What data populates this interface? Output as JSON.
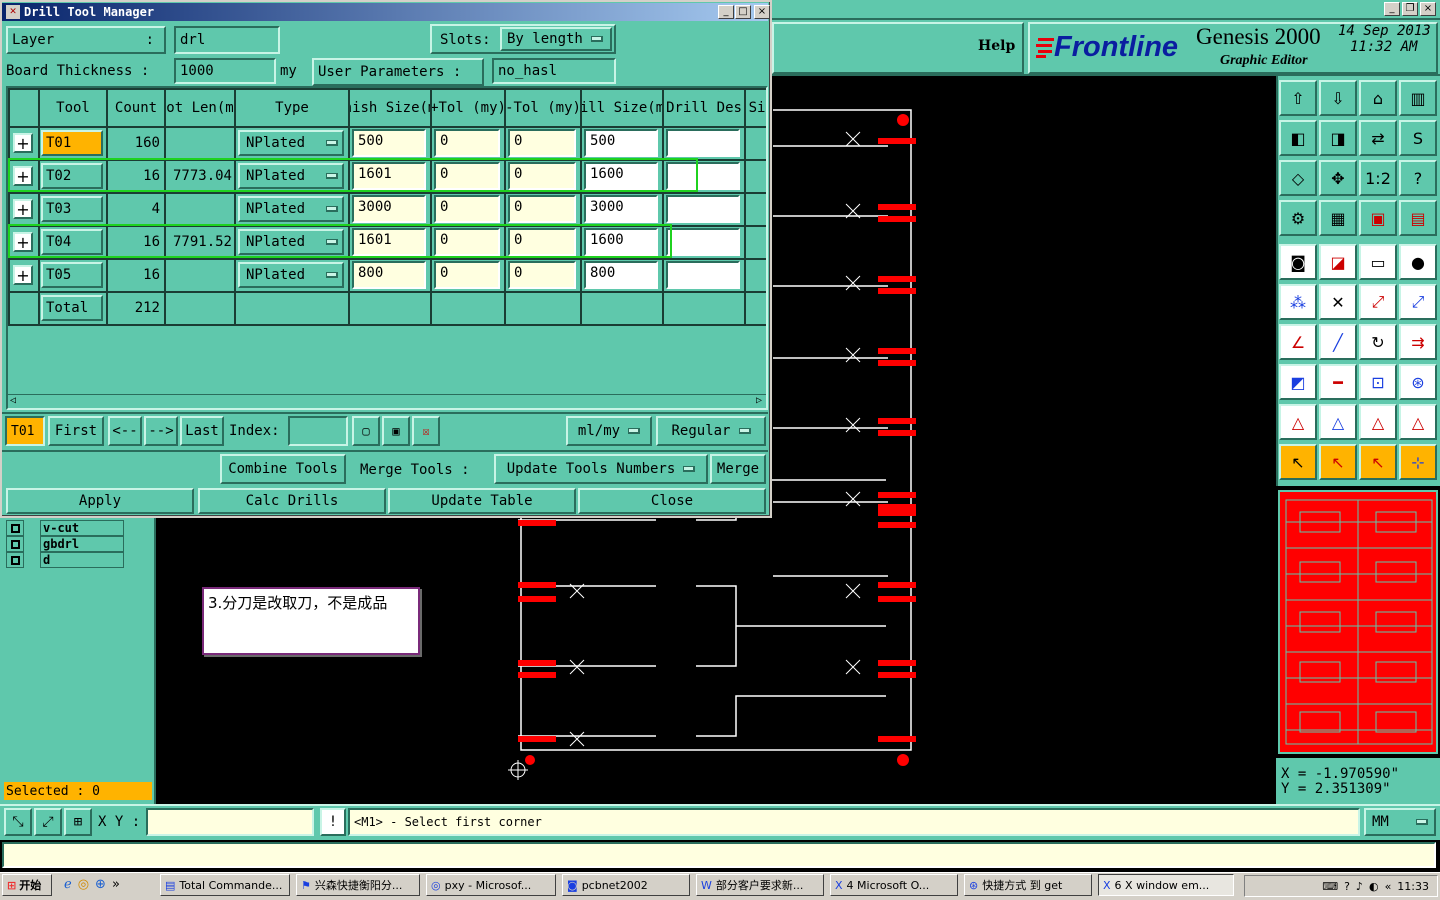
{
  "dialog": {
    "title": "Drill Tool Manager",
    "layer_label": "Layer",
    "layer_value": "drl",
    "slots_label": "Slots:",
    "slots_value": "By length",
    "board_thickness_label": "Board Thickness :",
    "board_thickness_value": "1000",
    "board_thickness_unit": "my",
    "user_params_label": "User Parameters :",
    "user_params_value": "no_hasl",
    "columns": [
      "Tool",
      "Count",
      "Slot Len(my)",
      "Type",
      "Finish Size(my)",
      "+Tol (my)",
      "-Tol (my)",
      "Drill Size(my)",
      "Drill Des",
      "Si"
    ],
    "rows": [
      {
        "tool": "T01",
        "count": "160",
        "slot": "",
        "type": "NPlated",
        "finish": "500",
        "ptol": "0",
        "mtol": "0",
        "drill": "500",
        "des": ""
      },
      {
        "tool": "T02",
        "count": "16",
        "slot": "7773.04",
        "type": "NPlated",
        "finish": "1601",
        "ptol": "0",
        "mtol": "0",
        "drill": "1600",
        "des": ""
      },
      {
        "tool": "T03",
        "count": "4",
        "slot": "",
        "type": "NPlated",
        "finish": "3000",
        "ptol": "0",
        "mtol": "0",
        "drill": "3000",
        "des": ""
      },
      {
        "tool": "T04",
        "count": "16",
        "slot": "7791.52",
        "type": "NPlated",
        "finish": "1601",
        "ptol": "0",
        "mtol": "0",
        "drill": "1600",
        "des": ""
      },
      {
        "tool": "T05",
        "count": "16",
        "slot": "",
        "type": "NPlated",
        "finish": "800",
        "ptol": "0",
        "mtol": "0",
        "drill": "800",
        "des": ""
      }
    ],
    "total_label": "Total",
    "total_count": "212",
    "nav": {
      "current": "T01",
      "first": "First",
      "prev": "<--",
      "next": "-->",
      "last": "Last",
      "index_label": "Index:",
      "units": "ml/my",
      "mode": "Regular"
    },
    "actions": {
      "combine": "Combine Tools",
      "merge_tools": "Merge Tools :",
      "update_numbers": "Update Tools Numbers",
      "merge": "Merge"
    },
    "bottom": {
      "apply": "Apply",
      "calc": "Calc Drills",
      "update_table": "Update Table",
      "close": "Close"
    }
  },
  "header": {
    "help": "Help",
    "brand": "Frontline",
    "product": "Genesis 2000",
    "subtitle": "Graphic Editor",
    "date": "14 Sep 2013",
    "time": "11:32 AM"
  },
  "layers": [
    {
      "name": "v-cut"
    },
    {
      "name": "gbdrl"
    },
    {
      "name": "d"
    }
  ],
  "selected": "Selected : 0",
  "note": "3.分刀是改取刀，不是成品",
  "coords": {
    "x": "X = -1.970590\"",
    "y": "Y = 2.351309\""
  },
  "status": {
    "xy_label": "X Y :",
    "message": "<M1> - Select first corner",
    "units": "MM"
  },
  "icons": [
    "open-job-icon",
    "save-icon",
    "home-icon",
    "window-icon",
    "pan-left-icon",
    "pan-right-icon",
    "swap-icon",
    "redraw-icon",
    "fit-icon",
    "center-icon",
    "zoom-1to1-icon",
    "help-icon",
    "settings-icon",
    "grid-icon",
    "snap-icon",
    "drill-icon",
    "layer-icon",
    "erase-icon",
    "ruler-icon",
    "circle-icon",
    "net-icon",
    "cross-icon",
    "point-red-icon",
    "point-icon",
    "angle-icon",
    "line-icon",
    "rotate-icon",
    "flip-icon",
    "select-red-icon",
    "line-red-icon",
    "measure-icon",
    "group-icon",
    "triangle-icon",
    "triangle2-icon",
    "triangle3-icon",
    "triangle4-icon",
    "pointer-icon",
    "pointer-box-icon",
    "pointer-box2-icon",
    "route-icon"
  ],
  "taskbar": {
    "start": "开始",
    "items": [
      "Total Commande...",
      "兴森快捷衡阳分...",
      "pxy - Microsof...",
      "pcbnet2002",
      "部分客户要求新...",
      "4 Microsoft O...",
      "快捷方式 到 get",
      "6 X window em..."
    ],
    "clock": "11:33"
  },
  "colors": {
    "teal": "#5fc8ac",
    "pad_red": "#ff0000",
    "outline": "#ffffff",
    "highlight": "#ffb300"
  }
}
